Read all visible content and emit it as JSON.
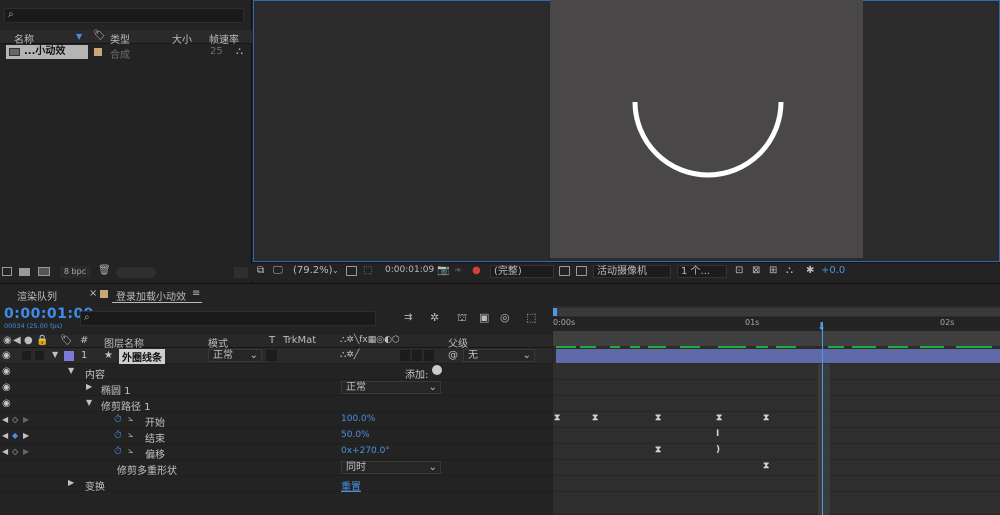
{
  "project": {
    "columns": [
      "名称",
      "类型",
      "大小",
      "帧速率"
    ],
    "items": [
      {
        "name": "...小动效",
        "type": "合成",
        "size": "",
        "fps": "25"
      }
    ],
    "bpc": "8 bpc"
  },
  "viewer": {
    "zoom": "(79.2%)",
    "timecode": "0:00:01:09",
    "resolution": "(完整)",
    "camera": "活动摄像机",
    "views": "1 个...",
    "exposure": "+0.0"
  },
  "timeline": {
    "tabs": [
      "渲染队列",
      "登录加载小动效"
    ],
    "current_time": "0:00:01:09",
    "frame_info": "00034 (25.00 fps)",
    "columns": {
      "hash": "#",
      "layer_name": "图层名称",
      "mode": "模式",
      "t": "T",
      "trkmat": "TrkMat",
      "parent": "父级"
    },
    "ruler": [
      "0:00s",
      "01s",
      "02s"
    ],
    "layer": {
      "index": "1",
      "name": "外圈线条",
      "mode": "正常",
      "parent": "无"
    },
    "rows": {
      "content": "内容",
      "add": "添加:",
      "ellipse": "椭圆 1",
      "ellipse_mode": "正常",
      "trim": "修剪路径 1",
      "start_label": "开始",
      "start_value": "100.0%",
      "end_label": "结束",
      "end_value": "50.0%",
      "offset_label": "偏移",
      "offset_value": "0x+270.0°",
      "trim_multi": "修剪多重形状",
      "trim_multi_value": "同时",
      "transform": "变换",
      "reset": "重置"
    }
  },
  "colors": {
    "accent_blue": "#3d8ee8",
    "label_purple": "#7b7bd6",
    "layer_bar": "#5f6aa8",
    "work_area_green": "#1fae3c"
  }
}
